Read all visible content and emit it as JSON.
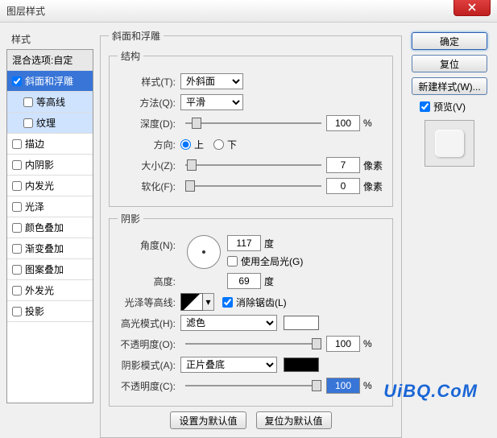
{
  "window": {
    "title": "图层样式"
  },
  "left": {
    "header": "样式",
    "blend": "混合选项:自定",
    "bevel": "斜面和浮雕",
    "contour": "等高线",
    "texture": "纹理",
    "stroke": "描边",
    "innerShadow": "内阴影",
    "innerGlow": "内发光",
    "satin": "光泽",
    "colorOverlay": "颜色叠加",
    "gradientOverlay": "渐变叠加",
    "patternOverlay": "图案叠加",
    "outerGlow": "外发光",
    "dropShadow": "投影"
  },
  "bevel": {
    "groupTitle": "斜面和浮雕",
    "structTitle": "结构",
    "styleLabel": "样式(T):",
    "styleValue": "外斜面",
    "techLabel": "方法(Q):",
    "techValue": "平滑",
    "depthLabel": "深度(D):",
    "depthValue": "100",
    "depthUnit": "%",
    "dirLabel": "方向:",
    "dirUp": "上",
    "dirDown": "下",
    "sizeLabel": "大小(Z):",
    "sizeValue": "7",
    "sizeUnit": "像素",
    "softLabel": "软化(F):",
    "softValue": "0",
    "softUnit": "像素"
  },
  "shading": {
    "groupTitle": "阴影",
    "angleLabel": "角度(N):",
    "angleValue": "117",
    "angleUnit": "度",
    "globalLight": "使用全局光(G)",
    "altLabel": "高度:",
    "altValue": "69",
    "altUnit": "度",
    "glossLabel": "光泽等高线:",
    "antialias": "消除锯齿(L)",
    "hiliteLabel": "高光模式(H):",
    "hiliteValue": "滤色",
    "hiliteOpLabel": "不透明度(O):",
    "hiliteOpValue": "100",
    "hiliteOpUnit": "%",
    "shadowLabel": "阴影模式(A):",
    "shadowValue": "正片叠底",
    "shadowOpLabel": "不透明度(C):",
    "shadowOpValue": "100",
    "shadowOpUnit": "%"
  },
  "buttons": {
    "makeDefault": "设置为默认值",
    "resetDefault": "复位为默认值"
  },
  "right": {
    "ok": "确定",
    "cancel": "复位",
    "newStyle": "新建样式(W)...",
    "preview": "预览(V)"
  },
  "watermark": "UiBQ.CoM"
}
